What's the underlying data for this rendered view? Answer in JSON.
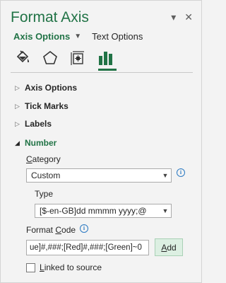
{
  "pane": {
    "title": "Format Axis",
    "pin_icon": "chevron-down-icon",
    "close_icon": "close-icon",
    "accent_color": "#217346"
  },
  "tabs": {
    "active": "Axis Options",
    "other": "Text Options"
  },
  "icons": [
    "fill-line-icon",
    "effects-pentagon-icon",
    "size-properties-icon",
    "axis-options-bar-icon"
  ],
  "sections": {
    "axis_options": "Axis Options",
    "tick_marks": "Tick Marks",
    "labels": "Labels",
    "number": "Number"
  },
  "number": {
    "category_label_pre": "",
    "category_label_u": "C",
    "category_label_post": "ategory",
    "category_value": "Custom",
    "type_label": "Type",
    "type_value": "[$-en-GB]dd mmmm yyyy;@",
    "format_code_label_pre": "Format ",
    "format_code_label_u": "C",
    "format_code_label_post": "ode",
    "format_code_value": "ue]#,###;[Red]#,###;[Green]~0",
    "add_label_u": "A",
    "add_label_post": "dd",
    "linked_label_u": "L",
    "linked_label_post": "inked to source",
    "linked_checked": false
  }
}
